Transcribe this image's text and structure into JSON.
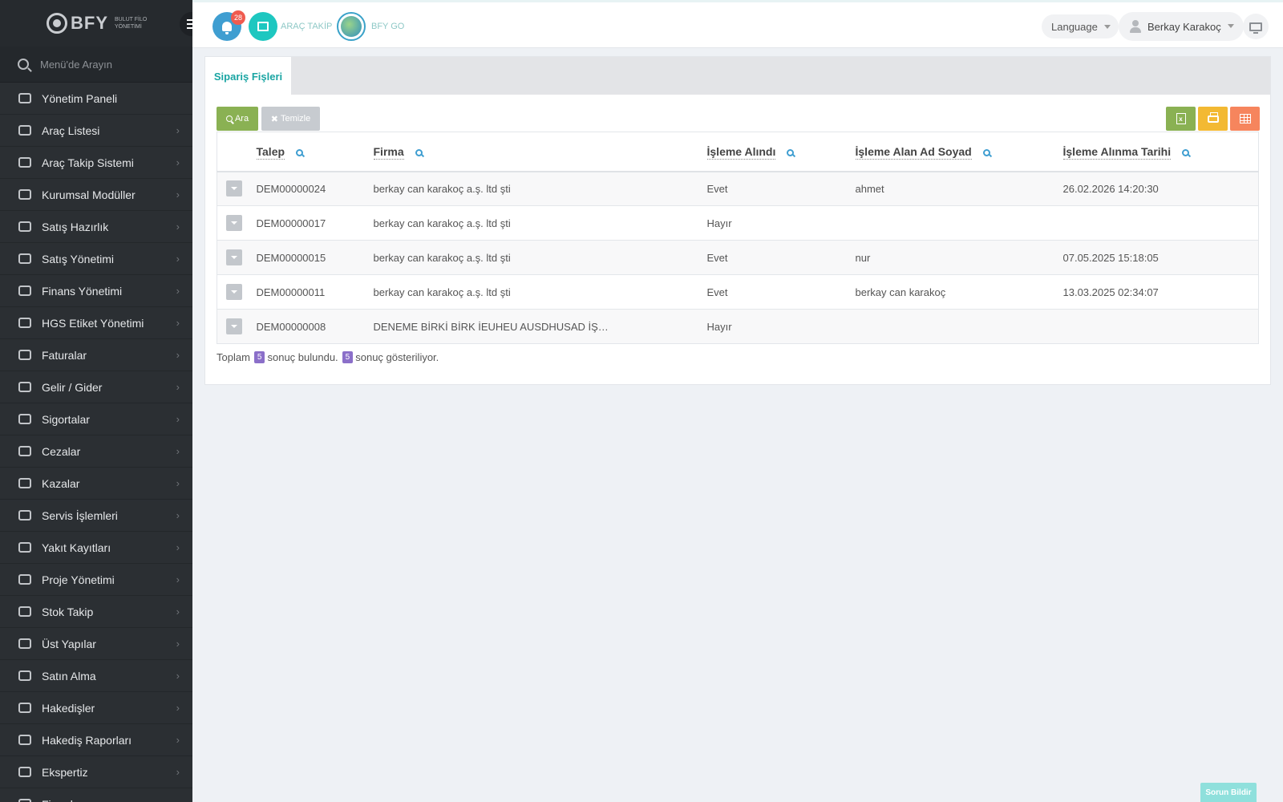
{
  "brand": {
    "name": "BFY",
    "subtitle": "BULUT FİLO YÖNETİMİ"
  },
  "sidebar": {
    "search_placeholder": "Menü'de Arayın",
    "items": [
      {
        "label": "Yönetim Paneli",
        "icon": "dashboard-icon"
      },
      {
        "label": "Araç Listesi",
        "icon": "bus-icon"
      },
      {
        "label": "Araç Takip Sistemi",
        "icon": "map-pin-icon"
      },
      {
        "label": "Kurumsal Modüller",
        "icon": "server-icon"
      },
      {
        "label": "Satış Hazırlık",
        "icon": "book-icon"
      },
      {
        "label": "Satış Yönetimi",
        "icon": "credit-card-icon"
      },
      {
        "label": "Finans Yönetimi",
        "icon": "money-icon"
      },
      {
        "label": "HGS Etiket Yönetimi",
        "icon": "tag-icon"
      },
      {
        "label": "Faturalar",
        "icon": "file-icon"
      },
      {
        "label": "Gelir / Gider",
        "icon": "money-bill-icon"
      },
      {
        "label": "Sigortalar",
        "icon": "umbrella-icon"
      },
      {
        "label": "Cezalar",
        "icon": "close-circle-icon"
      },
      {
        "label": "Kazalar",
        "icon": "car-crash-icon"
      },
      {
        "label": "Servis İşlemleri",
        "icon": "check-circle-icon"
      },
      {
        "label": "Yakıt Kayıtları",
        "icon": "fuel-icon"
      },
      {
        "label": "Proje Yönetimi",
        "icon": "briefcase-icon"
      },
      {
        "label": "Stok Takip",
        "icon": "inbox-icon"
      },
      {
        "label": "Üst Yapılar",
        "icon": "truck-icon"
      },
      {
        "label": "Satın Alma",
        "icon": "card-icon"
      },
      {
        "label": "Hakedişler",
        "icon": "truck-icon"
      },
      {
        "label": "Hakediş Raporları",
        "icon": "truck-icon"
      },
      {
        "label": "Ekspertiz",
        "icon": "report-icon"
      },
      {
        "label": "Firmalar",
        "icon": "building-icon"
      }
    ]
  },
  "topbar": {
    "notification_count": "28",
    "arac_takip_label": "ARAÇ TAKİP",
    "bfy_go_label": "BFY GO",
    "language_label": "Language",
    "user_name": "Berkay Karakoç"
  },
  "main": {
    "tab_label": "Sipariş Fişleri",
    "search_button": "Ara",
    "clear_button": "Temizle",
    "columns": [
      "Talep",
      "Firma",
      "İşleme Alındı",
      "İşleme Alan Ad Soyad",
      "İşleme Alınma Tarihi"
    ],
    "rows": [
      {
        "talep": "DEM00000024",
        "firma": "berkay can karakoç a.ş. ltd şti",
        "alindi": "Evet",
        "alan": "ahmet",
        "tarih": "26.02.2026 14:20:30"
      },
      {
        "talep": "DEM00000017",
        "firma": "berkay can karakoç a.ş. ltd şti",
        "alindi": "Hayır",
        "alan": "",
        "tarih": ""
      },
      {
        "talep": "DEM00000015",
        "firma": "berkay can karakoç a.ş. ltd şti",
        "alindi": "Evet",
        "alan": "nur",
        "tarih": "07.05.2025 15:18:05"
      },
      {
        "talep": "DEM00000011",
        "firma": "berkay can karakoç a.ş. ltd şti",
        "alindi": "Evet",
        "alan": "berkay can karakoç",
        "tarih": "13.03.2025 02:34:07"
      },
      {
        "talep": "DEM00000008",
        "firma": "DENEME BİRKİ BİRK İEUHEU AUSDHUSAD İŞ…",
        "alindi": "Hayır",
        "alan": "",
        "tarih": ""
      }
    ],
    "summary": {
      "prefix": "Toplam",
      "total": "5",
      "middle": "sonuç bulundu.",
      "shown": "5",
      "suffix": "sonuç gösteriliyor."
    }
  },
  "report_button": "Sorun Bildir"
}
